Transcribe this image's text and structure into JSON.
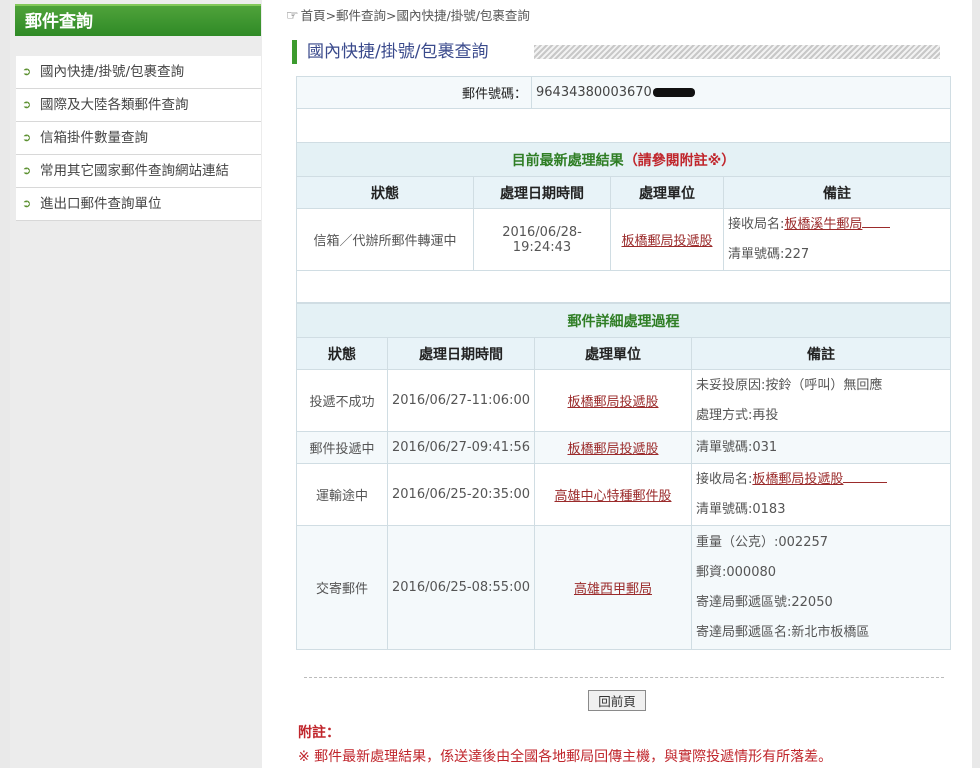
{
  "sidebar": {
    "title": "郵件查詢",
    "items": [
      {
        "label": "國內快捷/掛號/包裹查詢"
      },
      {
        "label": "國際及大陸各類郵件查詢"
      },
      {
        "label": "信箱掛件數量查詢"
      },
      {
        "label": "常用其它國家郵件查詢網站連結"
      },
      {
        "label": "進出口郵件查詢單位"
      }
    ]
  },
  "breadcrumb": {
    "icon": "hand-pointer-icon",
    "text": "首頁>郵件查詢>國內快捷/掛號/包裹查詢"
  },
  "page_title": "國內快捷/掛號/包裹查詢",
  "tracking": {
    "label": "郵件號碼：",
    "number": "96434380003670"
  },
  "latest": {
    "title": "目前最新處理結果",
    "title_note": "（請參閱附註※）",
    "headers": [
      "狀態",
      "處理日期時間",
      "處理單位",
      "備註"
    ],
    "row": {
      "status": "信箱／代辦所郵件轉運中",
      "datetime": "2016/06/28-19:24:43",
      "unit": "板橋郵局投遞股",
      "note_prefix": "接收局名:",
      "note_link": "板橋溪牛郵局",
      "note2": "清單號碼:227"
    }
  },
  "detail": {
    "title": "郵件詳細處理過程",
    "headers": [
      "狀態",
      "處理日期時間",
      "處理單位",
      "備註"
    ],
    "rows": [
      {
        "status": "投遞不成功",
        "datetime": "2016/06/27-11:06:00",
        "unit": "板橋郵局投遞股",
        "notes": [
          "未妥投原因:按鈴（呼叫）無回應",
          "處理方式:再投"
        ]
      },
      {
        "status": "郵件投遞中",
        "datetime": "2016/06/27-09:41:56",
        "unit": "板橋郵局投遞股",
        "notes": [
          "清單號碼:031"
        ]
      },
      {
        "status": "運輸途中",
        "datetime": "2016/06/25-20:35:00",
        "unit": "高雄中心特種郵件股",
        "note_prefix": "接收局名:",
        "note_link": "板橋郵局投遞股",
        "notes": [
          "清單號碼:0183"
        ]
      },
      {
        "status": "交寄郵件",
        "datetime": "2016/06/25-08:55:00",
        "unit": "高雄西甲郵局",
        "notes": [
          "重量（公克）:002257",
          "郵資:000080",
          "寄達局郵遞區號:22050",
          "寄達局郵遞區名:新北市板橋區"
        ]
      }
    ]
  },
  "back_button": "回前頁",
  "footnote": {
    "title": "附註：",
    "text": "※ 郵件最新處理結果，係送達後由全國各地郵局回傳主機，與實際投遞情形有所落差。"
  },
  "colors": {
    "accent_green": "#3c9b2e",
    "link_red": "#9b2b2b",
    "note_red": "#c0262c",
    "header_bg": "#e8f3f8"
  }
}
